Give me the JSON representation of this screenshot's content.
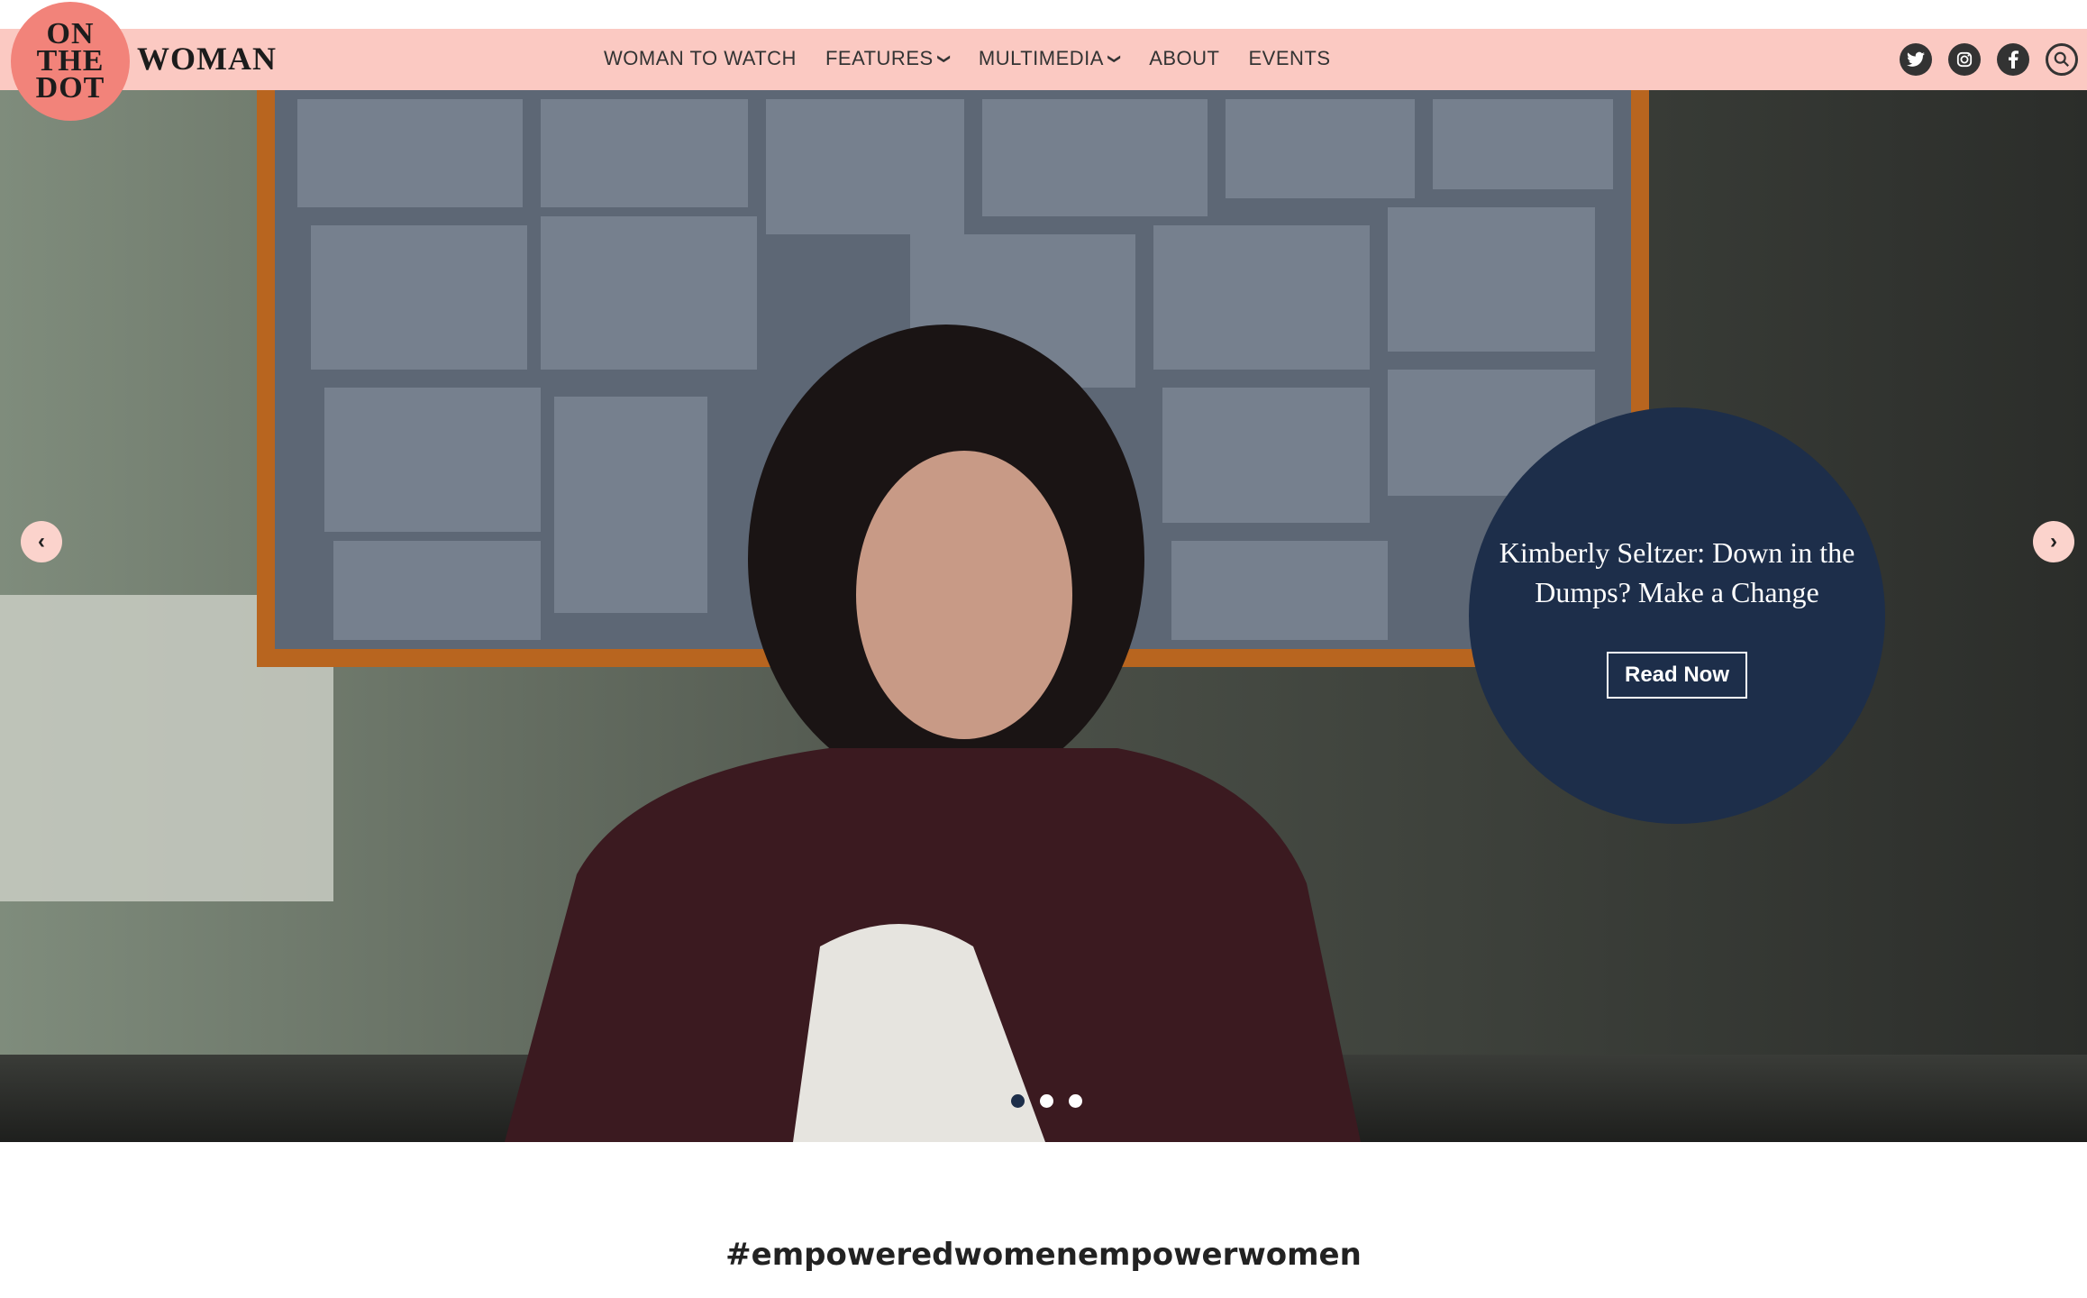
{
  "brand": {
    "logo_lines": [
      "ON",
      "THE",
      "DOT"
    ],
    "wordmark": "WOMAN"
  },
  "nav": {
    "items": [
      {
        "label": "WOMAN TO WATCH",
        "dropdown": false
      },
      {
        "label": "FEATURES",
        "dropdown": true
      },
      {
        "label": "MULTIMEDIA",
        "dropdown": true
      },
      {
        "label": "ABOUT",
        "dropdown": false
      },
      {
        "label": "EVENTS",
        "dropdown": false
      }
    ]
  },
  "socials": [
    "twitter-icon",
    "instagram-icon",
    "facebook-icon",
    "search-icon"
  ],
  "hero": {
    "caption_title": "Kimberly Seltzer: Down in the Dumps? Make a Change",
    "cta_label": "Read Now",
    "prev_icon": "‹",
    "next_icon": "›",
    "slide_count": 3,
    "active_slide": 1
  },
  "hashtag": "#empoweredwomenempowerwomen",
  "colors": {
    "topbar": "#fbc9c2",
    "logo": "#f2837a",
    "caption_circle": "#1d2e4a",
    "text_dark": "#333333"
  }
}
